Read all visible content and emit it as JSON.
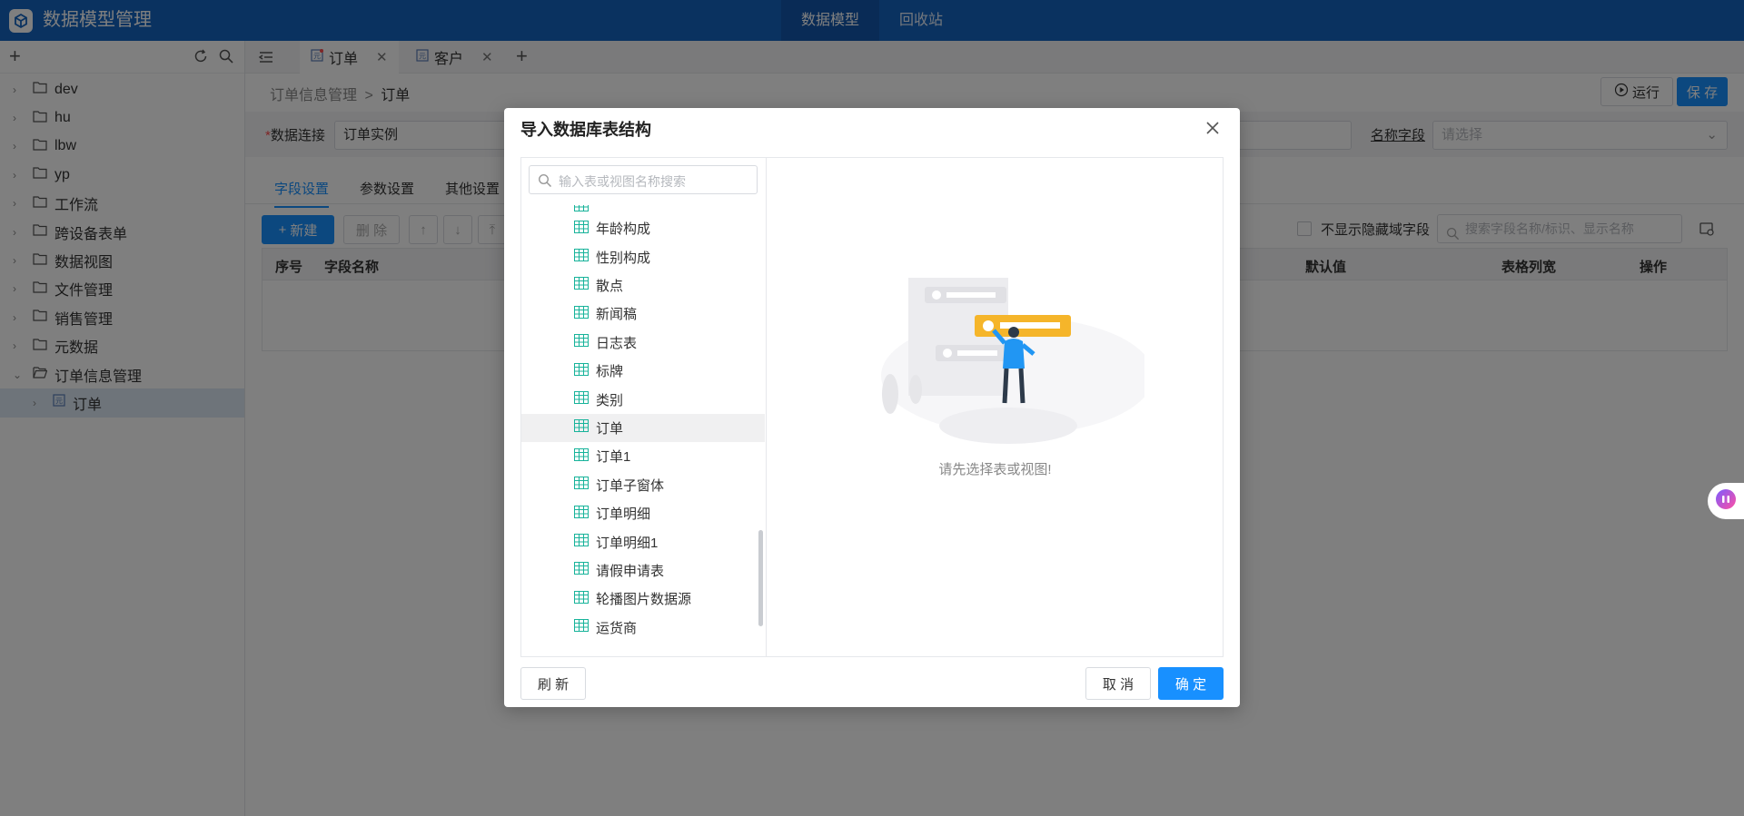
{
  "app": {
    "title": "数据模型管理"
  },
  "topnav": [
    {
      "label": "数据模型",
      "active": true
    },
    {
      "label": "回收站",
      "active": false
    }
  ],
  "sidebar": {
    "items": [
      {
        "label": "dev"
      },
      {
        "label": "hu"
      },
      {
        "label": "lbw"
      },
      {
        "label": "yp"
      },
      {
        "label": "工作流"
      },
      {
        "label": "跨设备表单"
      },
      {
        "label": "数据视图"
      },
      {
        "label": "文件管理"
      },
      {
        "label": "销售管理"
      },
      {
        "label": "元数据"
      },
      {
        "label": "订单信息管理",
        "expanded": true
      }
    ],
    "child": {
      "label": "订单"
    }
  },
  "tabs": [
    {
      "label": "订单",
      "active": true
    },
    {
      "label": "客户",
      "active": false
    }
  ],
  "breadcrumb": {
    "parent": "订单信息管理",
    "separator": ">",
    "current": "订单"
  },
  "header_buttons": {
    "run": "运行",
    "save": "保 存"
  },
  "form": {
    "connection_label": "数据连接",
    "required_mark": "*",
    "connection_value": "订单实例",
    "name_field_label": "名称字段",
    "name_field_placeholder": "请选择"
  },
  "subtabs": [
    "字段设置",
    "参数设置",
    "其他设置"
  ],
  "toolbar": {
    "new": "新建",
    "delete": "删 除",
    "hide_label": "不显示隐藏域字段",
    "search_placeholder": "搜索字段名称/标识、显示名称"
  },
  "table_headers": {
    "seq": "序号",
    "field_name": "字段名称",
    "default": "默认值",
    "width": "表格列宽",
    "ops": "操作"
  },
  "dialog": {
    "title": "导入数据库表结构",
    "search_placeholder": "输入表或视图名称搜索",
    "items": [
      {
        "label": "年龄构成"
      },
      {
        "label": "性别构成"
      },
      {
        "label": "散点"
      },
      {
        "label": "新闻稿"
      },
      {
        "label": "日志表"
      },
      {
        "label": "标牌"
      },
      {
        "label": "类别"
      },
      {
        "label": "订单",
        "selected": true
      },
      {
        "label": "订单1"
      },
      {
        "label": "订单子窗体"
      },
      {
        "label": "订单明细"
      },
      {
        "label": "订单明细1"
      },
      {
        "label": "请假申请表"
      },
      {
        "label": "轮播图片数据源"
      },
      {
        "label": "运货商"
      }
    ],
    "empty_text": "请先选择表或视图!",
    "refresh": "刷 新",
    "cancel": "取 消",
    "confirm": "确 定"
  },
  "colors": {
    "topbar": "#1565c0",
    "accent": "#1890ff",
    "table_icon": "#17b39a",
    "illustration_yellow": "#f5b52a"
  }
}
